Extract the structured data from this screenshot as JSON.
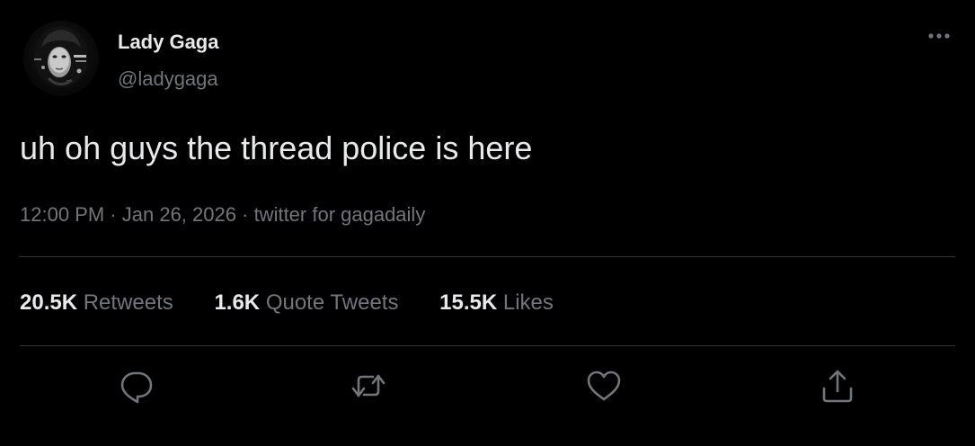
{
  "author": {
    "name": "Lady Gaga",
    "handle": "@ladygaga"
  },
  "tweet": {
    "text": "uh oh guys the thread police is here",
    "time": "12:00 PM",
    "date": "Jan 26, 2026",
    "source": "twitter for gagadaily",
    "separator": "·"
  },
  "stats": [
    {
      "value": "20.5K",
      "label": "Retweets"
    },
    {
      "value": "1.6K",
      "label": "Quote Tweets"
    },
    {
      "value": "15.5K",
      "label": "Likes"
    }
  ],
  "actions": [
    "reply-icon",
    "retweet-icon",
    "like-icon",
    "share-icon"
  ],
  "colors": {
    "background": "#000000",
    "primary_text": "#e7e9ea",
    "secondary_text": "#71767b",
    "divider": "#2f3336"
  }
}
